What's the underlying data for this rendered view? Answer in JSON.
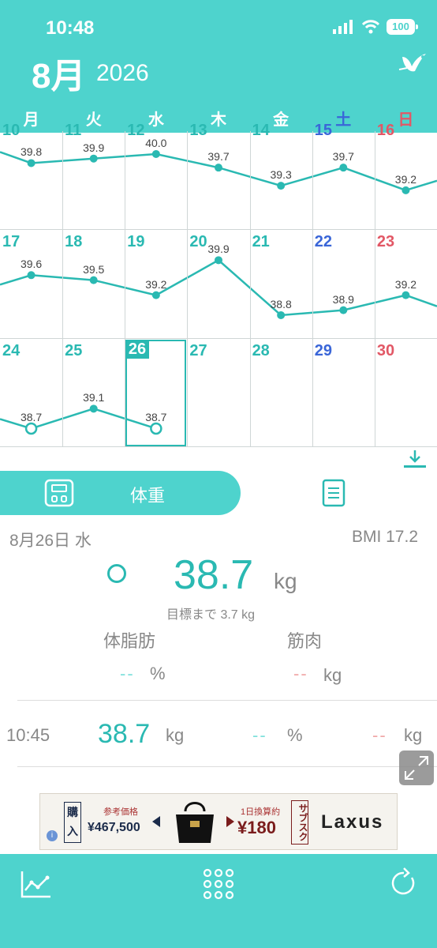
{
  "status": {
    "time": "10:48",
    "battery": "100"
  },
  "header": {
    "month": "8月",
    "year": "2026"
  },
  "weekdays": [
    "月",
    "火",
    "水",
    "木",
    "金",
    "土",
    "日"
  ],
  "calendar": {
    "weeks": [
      {
        "days": [
          "10",
          "11",
          "12",
          "13",
          "14",
          "15",
          "16"
        ],
        "weights": [
          "39.8",
          "39.9",
          "40.0",
          "39.7",
          "39.3",
          "39.7",
          "39.2"
        ]
      },
      {
        "days": [
          "17",
          "18",
          "19",
          "20",
          "21",
          "22",
          "23"
        ],
        "weights": [
          "39.6",
          "39.5",
          "39.2",
          "39.9",
          "38.8",
          "38.9",
          "39.2"
        ]
      },
      {
        "days": [
          "24",
          "25",
          "26",
          "27",
          "28",
          "29",
          "30"
        ],
        "weights": [
          "38.7",
          "39.1",
          "38.7",
          "",
          "",
          "",
          ""
        ]
      }
    ],
    "today": "26"
  },
  "tabs": {
    "weight_label": "体重"
  },
  "detail": {
    "date": "8月26日 水",
    "bmi": "BMI 17.2",
    "weight": "38.7",
    "weight_unit": "kg",
    "goal": "目標まで 3.7 kg",
    "fat_label": "体脂肪",
    "muscle_label": "筋肉",
    "fat_value": "--",
    "fat_unit": "%",
    "muscle_value": "--",
    "muscle_unit": "kg"
  },
  "record": {
    "time": "10:45",
    "weight": "38.7",
    "weight_unit": "kg",
    "fat": "--",
    "fat_unit": "%",
    "muscle": "--",
    "muscle_unit": "kg"
  },
  "ad": {
    "buy": "購入",
    "ref_label": "参考価格",
    "price": "¥467,500",
    "daily_label": "1日換算約",
    "daily_price": "¥180",
    "sub": "サブスク",
    "brand": "Laxus",
    "info": "i"
  },
  "colors": {
    "accent": "#4ed3cd",
    "teal_text": "#2ab9b2",
    "saturday": "#3a66d8",
    "sunday": "#e25866"
  }
}
